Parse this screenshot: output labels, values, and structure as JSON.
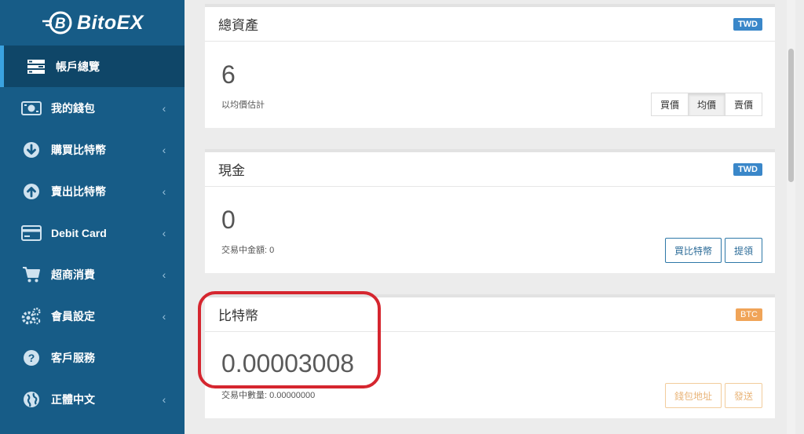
{
  "app": {
    "logo_text": "BitoEX",
    "logo_icon": "bitoex-b-logo-icon"
  },
  "sidebar": {
    "items": [
      {
        "label": "帳戶總覽",
        "icon": "account-overview-icon",
        "active": true,
        "has_chevron": false
      },
      {
        "label": "我的錢包",
        "icon": "wallet-icon",
        "active": false,
        "has_chevron": true
      },
      {
        "label": "購買比特幣",
        "icon": "download-circle-icon",
        "active": false,
        "has_chevron": true
      },
      {
        "label": "賣出比特幣",
        "icon": "upload-circle-icon",
        "active": false,
        "has_chevron": true
      },
      {
        "label": "Debit Card",
        "icon": "credit-card-icon",
        "active": false,
        "has_chevron": true
      },
      {
        "label": "超商消費",
        "icon": "shopping-cart-icon",
        "active": false,
        "has_chevron": true
      },
      {
        "label": "會員設定",
        "icon": "gears-icon",
        "active": false,
        "has_chevron": true
      },
      {
        "label": "客戶服務",
        "icon": "question-circle-icon",
        "active": false,
        "has_chevron": false
      },
      {
        "label": "正體中文",
        "icon": "globe-icon",
        "active": false,
        "has_chevron": true
      }
    ],
    "chevron_glyph": "‹"
  },
  "cards": {
    "total": {
      "title": "總資產",
      "badge": "TWD",
      "value": "6",
      "note": "以均價估計",
      "segments": [
        "買價",
        "均價",
        "賣價"
      ],
      "selected_segment": "均價"
    },
    "cash": {
      "title": "現金",
      "badge": "TWD",
      "value": "0",
      "note": "交易中金額: 0",
      "buttons": [
        "買比特幣",
        "提領"
      ]
    },
    "btc": {
      "title": "比特幣",
      "badge": "BTC",
      "value": "0.00003008",
      "note": "交易中數量: 0.00000000",
      "buttons": [
        "錢包地址",
        "發送"
      ]
    }
  },
  "colors": {
    "sidebar_bg": "#175c87",
    "sidebar_active_bg": "#0f4668",
    "twd_badge": "#3a87c9",
    "btc_badge": "#f0a458",
    "highlight_ring": "#d5262f"
  }
}
